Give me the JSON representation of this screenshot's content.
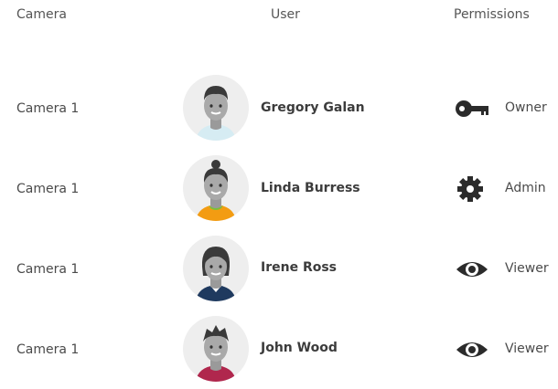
{
  "headers": {
    "camera": "Camera",
    "user": "User",
    "permissions": "Permissions"
  },
  "rows": [
    {
      "camera": "Camera 1",
      "user": "Gregory Galan",
      "permission": "Owner",
      "permission_icon": "key-icon",
      "avatar": "male-avatar-light-blue-shirt"
    },
    {
      "camera": "Camera 1",
      "user": "Linda Burress",
      "permission": "Admin",
      "permission_icon": "gear-icon",
      "avatar": "female-avatar-orange-shirt"
    },
    {
      "camera": "Camera 1",
      "user": "Irene Ross",
      "permission": "Viewer",
      "permission_icon": "eye-icon",
      "avatar": "female-avatar-navy-shirt"
    },
    {
      "camera": "Camera 1",
      "user": "John Wood",
      "permission": "Viewer",
      "permission_icon": "eye-icon",
      "avatar": "male-avatar-maroon-shirt"
    }
  ],
  "colors": {
    "icon": "#2b2b2b",
    "avatar_bg": "#eeeeee",
    "row1_shirt": "#d6ecf3",
    "row2_shirt": "#f39c12",
    "row3_shirt": "#1f3a5f",
    "row4_shirt": "#b0274d"
  }
}
